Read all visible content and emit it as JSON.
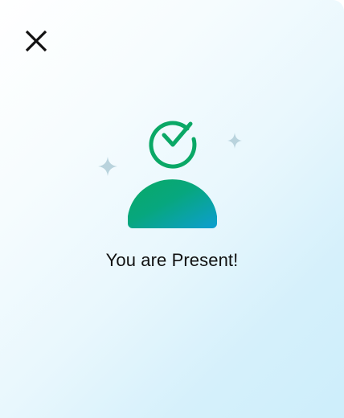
{
  "dialog": {
    "message": "You are Present!",
    "close_icon": "close-icon",
    "illustration_icon": "person-check-icon",
    "sparkle_icon": "sparkle-icon"
  },
  "colors": {
    "icon_green": "#0aa866",
    "icon_blue": "#0d9ed1",
    "sparkle": "#b9d3dd",
    "text": "#111111",
    "background_start": "#ffffff",
    "background_end": "#cdeefb"
  }
}
